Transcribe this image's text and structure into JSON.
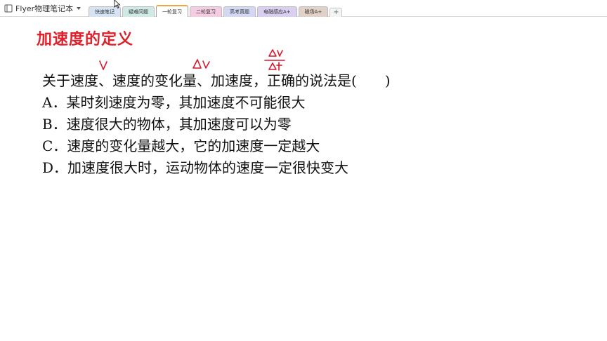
{
  "app": {
    "notebook_name": "Flyer物理笔记本"
  },
  "tabs": [
    {
      "label": "快速笔记",
      "color": "#d6e3f5"
    },
    {
      "label": "疑难问题",
      "color": "#cfe9e4"
    },
    {
      "label": "一轮复习",
      "color": "#f7ddb8",
      "active": true
    },
    {
      "label": "二轮复习",
      "color": "#f4cde3"
    },
    {
      "label": "高考真题",
      "color": "#d3d8f5"
    },
    {
      "label": "电磁感应A+",
      "color": "#d9cff0"
    },
    {
      "label": "磁场A+",
      "color": "#e0d2c8"
    }
  ],
  "tab_add_label": "+",
  "page": {
    "title": "加速度的定义",
    "question": "关于速度、速度的变化量、加速度，正确的说法是(　　)",
    "options": [
      "A．某时刻速度为零，其加速度不可能很大",
      "B．速度很大的物体，其加速度可以为零",
      "C．速度的变化量越大，它的加速度一定越大",
      "D．加速度很大时，运动物体的速度一定很快变大"
    ]
  },
  "colors": {
    "title": "#e0202a",
    "annotation_ink": "#d8162a"
  }
}
